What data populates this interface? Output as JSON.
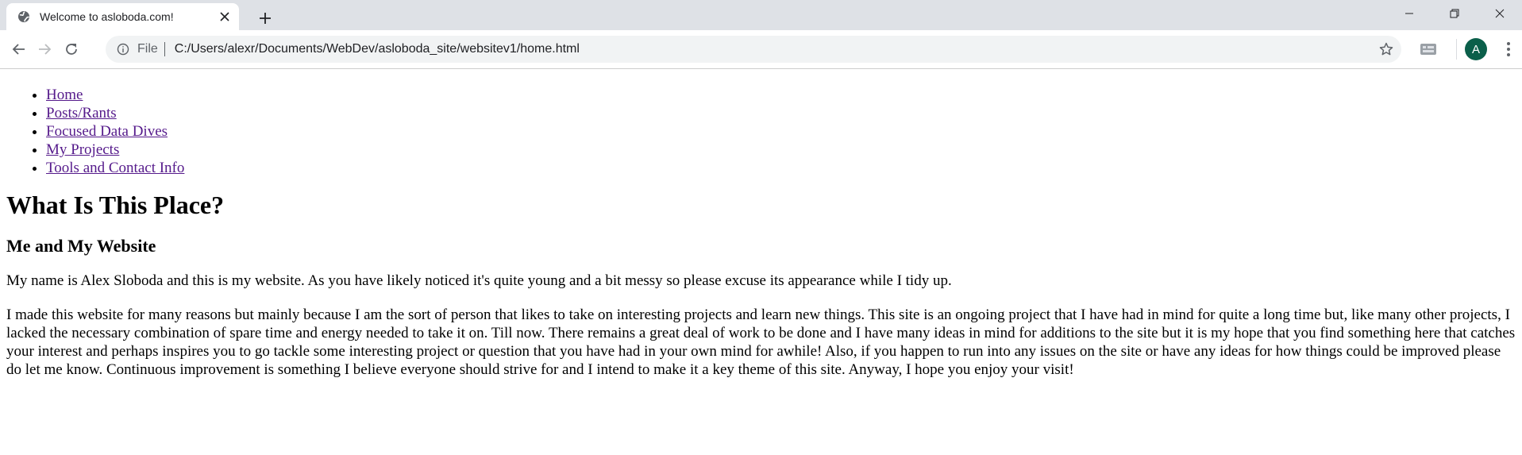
{
  "browser": {
    "tab_title": "Welcome to asloboda.com!",
    "new_tab_symbol": "+",
    "url_scheme": "File",
    "url": "C:/Users/alexr/Documents/WebDev/asloboda_site/websitev1/home.html",
    "profile_initial": "A",
    "profile_color": "#0b5f4a",
    "icons": [
      "globe-icon",
      "close-icon",
      "plus-icon",
      "minimize-icon",
      "restore-icon",
      "window-close-icon",
      "back-icon",
      "forward-icon",
      "reload-icon",
      "info-icon",
      "star-icon",
      "extension-icon",
      "menu-icon"
    ]
  },
  "nav": {
    "items": [
      {
        "label": "Home"
      },
      {
        "label": "Posts/Rants"
      },
      {
        "label": "Focused Data Dives"
      },
      {
        "label": "My Projects"
      },
      {
        "label": "Tools and Contact Info"
      }
    ],
    "link_color": "#551a8b"
  },
  "content": {
    "heading": "What Is This Place?",
    "subheading": "Me and My Website",
    "paragraph1": "My name is Alex Sloboda and this is my website. As you have likely noticed it's quite young and a bit messy so please excuse its appearance while I tidy up.",
    "paragraph2": "I made this website for many reasons but mainly because I am the sort of person that likes to take on interesting projects and learn new things. This site is an ongoing project that I have had in mind for quite a long time but, like many other projects, I lacked the necessary combination of spare time and energy needed to take it on. Till now. There remains a great deal of work to be done and I have many ideas in mind for additions to the site but it is my hope that you find something here that catches your interest and perhaps inspires you to go tackle some interesting project or question that you have had in your own mind for awhile! Also, if you happen to run into any issues on the site or have any ideas for how things could be improved please do let me know. Continuous improvement is something I believe everyone should strive for and I intend to make it a key theme of this site. Anyway, I hope you enjoy your visit!"
  }
}
